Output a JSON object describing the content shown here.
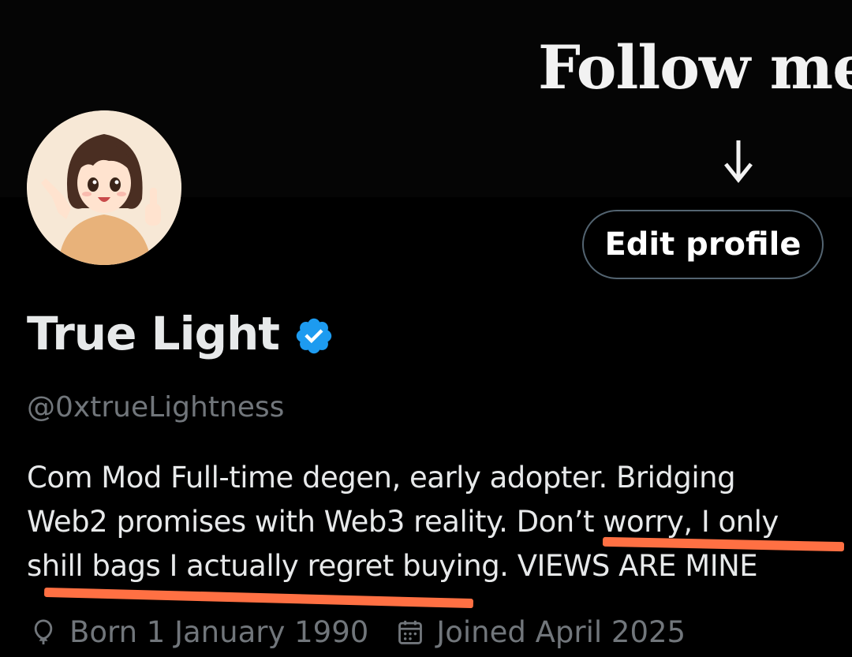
{
  "banner": {
    "text": "Follow me",
    "arrow_icon": "down-arrow-icon"
  },
  "profile": {
    "avatar_icon": "anime-girl-avatar",
    "edit_button_label": "Edit profile",
    "display_name": "True Light",
    "verified_icon": "verified-badge-icon",
    "handle": "@0xtrueLightness",
    "bio_lines": [
      "Com Mod    Full-time degen, early adopter. Bridging",
      "Web2 promises with Web3 reality. Don’t worry, I only",
      "shill bags I actually regret buying. VIEWS ARE MINE"
    ],
    "born": "Born 1 January 1990",
    "joined": "Joined April 2025",
    "born_icon": "balloon-icon",
    "joined_icon": "calendar-icon"
  },
  "colors": {
    "background": "#000000",
    "text_primary": "#e7e9ea",
    "text_secondary": "#71767b",
    "verified_blue": "#1d9bf0",
    "underline_orange": "#ff7043",
    "button_border": "#536471"
  }
}
